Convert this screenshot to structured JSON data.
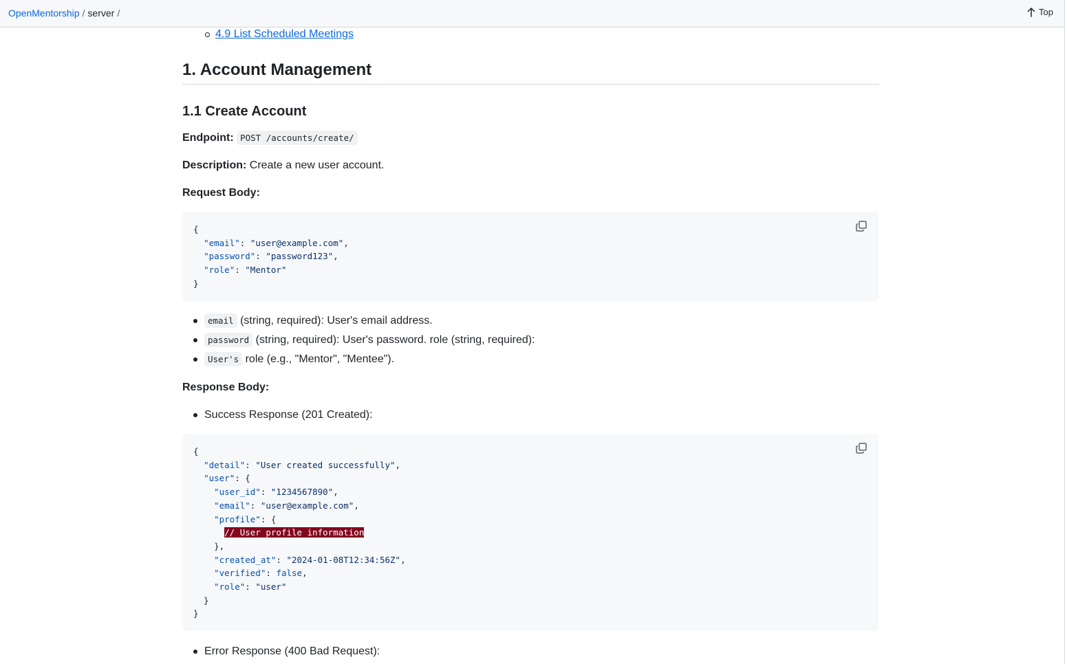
{
  "breadcrumb": {
    "owner": "OpenMentorship",
    "repo": "server",
    "sep1": "/",
    "sep2": "/"
  },
  "top_button": {
    "label": "Top",
    "icon": "arrow-up-icon"
  },
  "toc": {
    "last_item": "4.9 List Scheduled Meetings"
  },
  "section": {
    "h1": "1. Account Management",
    "h2": "1.1 Create Account",
    "endpoint_label": "Endpoint:",
    "endpoint_value": "POST /accounts/create/",
    "description_label": "Description:",
    "description_text": " Create a new user account.",
    "request_body_label": "Request Body:",
    "request_code": {
      "open": "{",
      "lines": [
        {
          "key": "\"email\"",
          "value": "\"user@example.com\"",
          "trail": ","
        },
        {
          "key": "\"password\"",
          "value": "\"password123\"",
          "trail": ","
        },
        {
          "key": "\"role\"",
          "value": "\"Mentor\"",
          "trail": ""
        }
      ],
      "close": "}"
    },
    "fields": [
      {
        "code": "email",
        "text": " (string, required): User's email address."
      },
      {
        "code": "password",
        "text": " (string, required): User's password. role (string, required):"
      },
      {
        "code": "User's",
        "text": " role (e.g., \"Mentor\", \"Mentee\")."
      }
    ],
    "response_body_label": "Response Body:",
    "success_item": "Success Response (201 Created):",
    "response_code": {
      "l1": "{",
      "detail_key": "\"detail\"",
      "detail_val": "\"User created successfully\"",
      "user_key": "\"user\"",
      "user_id_key": "\"user_id\"",
      "user_id_val": "\"1234567890\"",
      "email_key": "\"email\"",
      "email_val": "\"user@example.com\"",
      "profile_key": "\"profile\"",
      "comment": "// User profile information",
      "created_key": "\"created_at\"",
      "created_val": "\"2024-01-08T12:34:56Z\"",
      "verified_key": "\"verified\"",
      "verified_val": "false",
      "role_key": "\"role\"",
      "role_val": "\"user\""
    },
    "error_item": "Error Response (400 Bad Request):"
  },
  "icons": {
    "copy": "copy-icon"
  },
  "colors": {
    "link": "#0969da",
    "code_bg": "#f6f8fa",
    "comment_err_bg": "#82071e"
  }
}
